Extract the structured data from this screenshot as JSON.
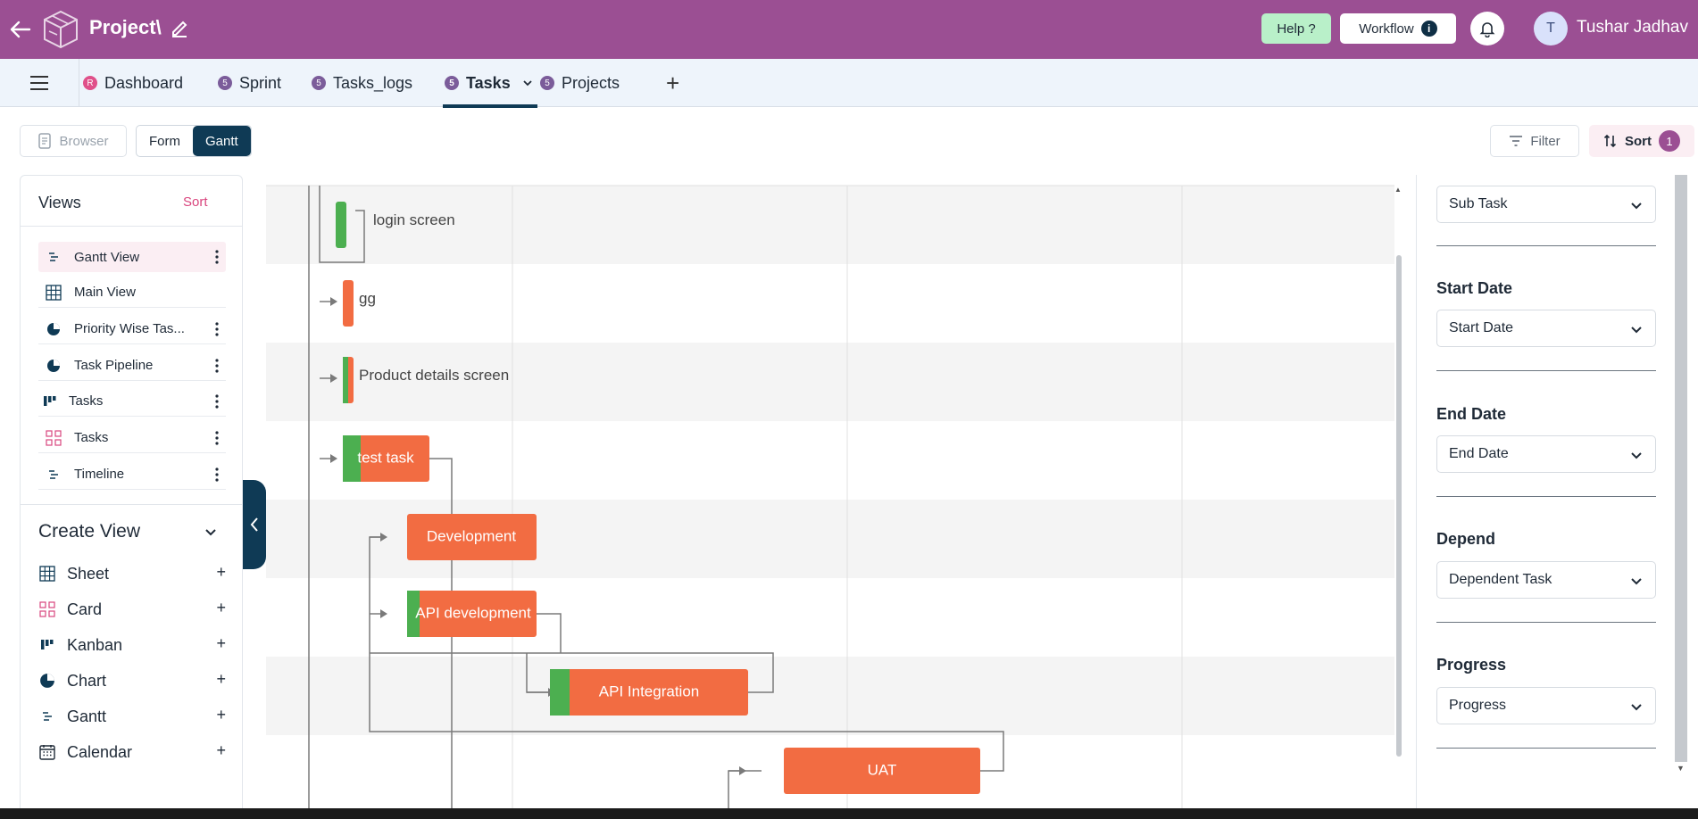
{
  "header": {
    "project_title": "Project\\",
    "help_label": "Help ?",
    "workflow_label": "Workflow",
    "avatar_initial": "T",
    "user_name": "Tushar Jadhav",
    "bg_color": "#9b4f93"
  },
  "tabs": [
    {
      "badge": "R",
      "label": "Dashboard"
    },
    {
      "badge": "5",
      "label": "Sprint"
    },
    {
      "badge": "5",
      "label": "Tasks_logs"
    },
    {
      "badge": "5",
      "label": "Tasks",
      "active": true
    },
    {
      "badge": "5",
      "label": "Projects"
    }
  ],
  "toolbar": {
    "browser_label": "Browser",
    "form_label": "Form",
    "gantt_label": "Gantt",
    "filter_label": "Filter",
    "sort_label": "Sort",
    "sort_count": "1"
  },
  "views": {
    "heading": "Views",
    "sort_label": "Sort",
    "items": [
      {
        "label": "Gantt View",
        "icon": "gantt-icon",
        "selected": true
      },
      {
        "label": "Main View",
        "icon": "grid-icon"
      },
      {
        "label": "Priority Wise Tas...",
        "icon": "pie-chart-icon"
      },
      {
        "label": "Task Pipeline",
        "icon": "pie-chart-icon"
      },
      {
        "label": "Tasks",
        "icon": "kanban-icon"
      },
      {
        "label": "Tasks",
        "icon": "card-icon"
      },
      {
        "label": "Timeline",
        "icon": "gantt-icon"
      }
    ]
  },
  "create_view": {
    "heading": "Create View",
    "items": [
      {
        "label": "Sheet",
        "icon": "grid-icon"
      },
      {
        "label": "Card",
        "icon": "card-icon"
      },
      {
        "label": "Kanban",
        "icon": "kanban-icon"
      },
      {
        "label": "Chart",
        "icon": "pie-chart-icon"
      },
      {
        "label": "Gantt",
        "icon": "gantt-icon"
      },
      {
        "label": "Calendar",
        "icon": "calendar-icon"
      }
    ]
  },
  "gantt": {
    "tasks": [
      {
        "name": "login screen",
        "label_outside": true
      },
      {
        "name": "gg",
        "label_outside": true
      },
      {
        "name": "Product details screen",
        "label_outside": true
      },
      {
        "name": "test task",
        "label_outside": false
      },
      {
        "name": "Development",
        "label_outside": false
      },
      {
        "name": "API development",
        "label_outside": false
      },
      {
        "name": "API Integration",
        "label_outside": false
      },
      {
        "name": "UAT",
        "label_outside": false
      }
    ],
    "bar_color": "#f26c42",
    "progress_color": "#4caf50"
  },
  "settings_panel": {
    "fields": [
      {
        "label": "",
        "value": "Sub Task"
      },
      {
        "label": "Start Date",
        "value": "Start Date"
      },
      {
        "label": "End Date",
        "value": "End Date"
      },
      {
        "label": "Depend",
        "value": "Dependent Task"
      },
      {
        "label": "Progress",
        "value": "Progress"
      }
    ]
  }
}
